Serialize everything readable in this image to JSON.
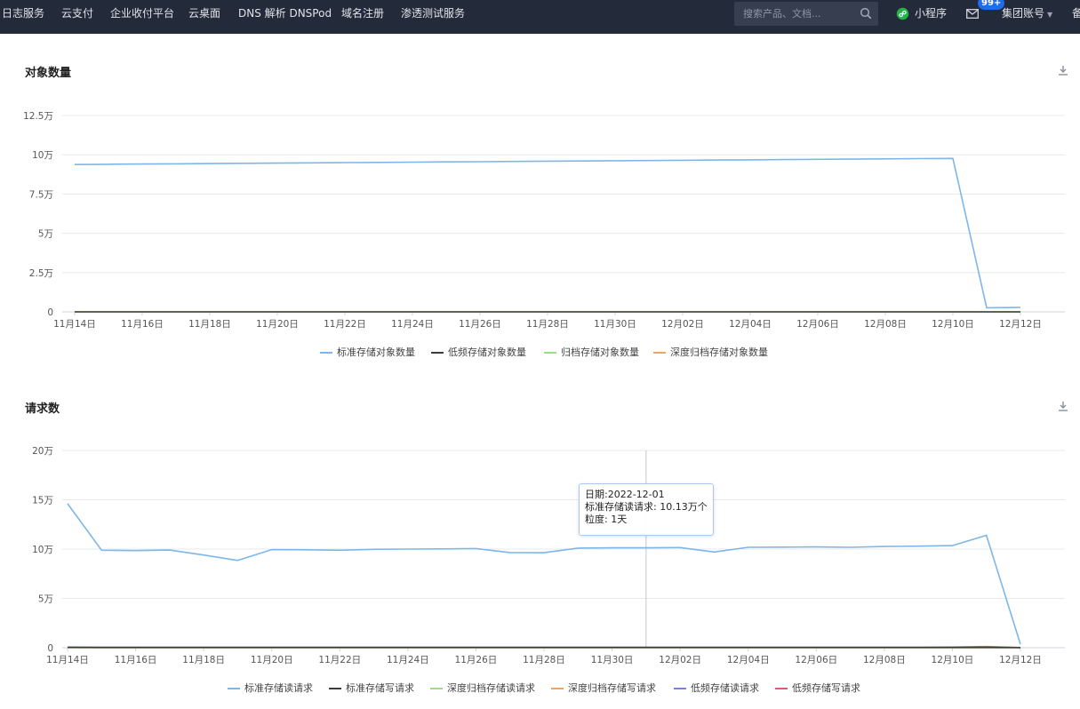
{
  "nav": {
    "items": [
      "日志服务",
      "云支付",
      "企业收付平台",
      "云桌面",
      "DNS 解析 DNSPod",
      "域名注册",
      "渗透测试服务"
    ],
    "search_placeholder": "搜索产品、文档...",
    "mini_program": "小程序",
    "mail_badge": "99+",
    "account": "集团账号",
    "overflow": "备"
  },
  "icons": {
    "search": "search-icon",
    "mini_program": "mini-program-icon",
    "mail": "mail-icon",
    "download": "download-icon"
  },
  "colors": {
    "topbar": "#232a39",
    "std_blue": "#7eb6ea",
    "low_dark": "#3c3c3c",
    "archive_green": "#98e086",
    "deep_orange": "#f5a35b",
    "low_read_purple": "#7b7fe0",
    "low_write_pink": "#e8537a"
  },
  "panels": {
    "objects": {
      "title": "对象数量"
    },
    "requests": {
      "title": "请求数"
    }
  },
  "tooltip": {
    "date": "日期:2022-12-01",
    "value": "标准存储读请求: 10.13万个",
    "granularity": "粒度:  1天"
  },
  "chart_data": [
    {
      "type": "line",
      "title": "对象数量",
      "xlabel": "",
      "ylabel": "",
      "x": [
        "11-14",
        "11-15",
        "11-16",
        "11-17",
        "11-18",
        "11-19",
        "11-20",
        "11-21",
        "11-22",
        "11-23",
        "11-24",
        "11-25",
        "11-26",
        "11-27",
        "11-28",
        "11-29",
        "11-30",
        "12-01",
        "12-02",
        "12-03",
        "12-04",
        "12-05",
        "12-06",
        "12-07",
        "12-08",
        "12-09",
        "12-10",
        "12-11",
        "12-12"
      ],
      "xticks": [
        "11月14日",
        "11月16日",
        "11月18日",
        "11月20日",
        "11月22日",
        "11月24日",
        "11月26日",
        "11月28日",
        "11月30日",
        "12月02日",
        "12月04日",
        "12月06日",
        "12月08日",
        "12月10日",
        "12月12日"
      ],
      "yticks": [
        "0",
        "2.5万",
        "5万",
        "7.5万",
        "10万",
        "12.5万"
      ],
      "ylim": [
        0,
        125000
      ],
      "grid": true,
      "legend_position": "bottom",
      "series": [
        {
          "name": "标准存储对象数量",
          "color": "#7eb6ea",
          "values": [
            93800,
            93950,
            94100,
            94250,
            94400,
            94550,
            94700,
            94850,
            95000,
            95150,
            95300,
            95450,
            95600,
            95750,
            95900,
            96050,
            96200,
            96350,
            96500,
            96650,
            96800,
            96950,
            97100,
            97250,
            97400,
            97550,
            97700,
            2600,
            2800
          ]
        },
        {
          "name": "低频存储对象数量",
          "color": "#3c3c3c",
          "values": [
            0,
            0,
            0,
            0,
            0,
            0,
            0,
            0,
            0,
            0,
            0,
            0,
            0,
            0,
            0,
            0,
            0,
            0,
            0,
            0,
            0,
            0,
            0,
            0,
            0,
            0,
            0,
            0,
            0
          ]
        },
        {
          "name": "归档存储对象数量",
          "color": "#98e086",
          "values": [
            0,
            0,
            0,
            0,
            0,
            0,
            0,
            0,
            0,
            0,
            0,
            0,
            0,
            0,
            0,
            0,
            0,
            0,
            0,
            0,
            0,
            0,
            0,
            0,
            0,
            0,
            0,
            0,
            0
          ]
        },
        {
          "name": "深度归档存储对象数量",
          "color": "#f5a35b",
          "values": [
            0,
            0,
            0,
            0,
            0,
            0,
            0,
            0,
            0,
            0,
            0,
            0,
            0,
            0,
            0,
            0,
            0,
            0,
            0,
            0,
            0,
            0,
            0,
            0,
            0,
            0,
            0,
            0,
            0
          ]
        }
      ]
    },
    {
      "type": "line",
      "title": "请求数",
      "xlabel": "",
      "ylabel": "",
      "x": [
        "11-14",
        "11-15",
        "11-16",
        "11-17",
        "11-18",
        "11-19",
        "11-20",
        "11-21",
        "11-22",
        "11-23",
        "11-24",
        "11-25",
        "11-26",
        "11-27",
        "11-28",
        "11-29",
        "11-30",
        "12-01",
        "12-02",
        "12-03",
        "12-04",
        "12-05",
        "12-06",
        "12-07",
        "12-08",
        "12-09",
        "12-10",
        "12-11",
        "12-12"
      ],
      "xticks": [
        "11月14日",
        "11月16日",
        "11月18日",
        "11月20日",
        "11月22日",
        "11月24日",
        "11月26日",
        "11月28日",
        "11月30日",
        "12月02日",
        "12月04日",
        "12月06日",
        "12月08日",
        "12月10日",
        "12月12日"
      ],
      "yticks": [
        "0",
        "5万",
        "10万",
        "15万",
        "20万"
      ],
      "ylim": [
        0,
        200000
      ],
      "grid": true,
      "legend_position": "bottom",
      "series": [
        {
          "name": "标准存储读请求",
          "color": "#7eb6ea",
          "values": [
            146000,
            98800,
            98500,
            99000,
            94000,
            88500,
            99500,
            99300,
            98800,
            99700,
            100000,
            100200,
            100500,
            96500,
            96300,
            101000,
            101300,
            101300,
            101500,
            97000,
            101800,
            102000,
            102200,
            101800,
            102600,
            103000,
            103500,
            114000,
            3500
          ]
        },
        {
          "name": "标准存储写请求",
          "color": "#3c3c3c",
          "values": [
            400,
            300,
            300,
            300,
            300,
            300,
            300,
            300,
            300,
            300,
            300,
            300,
            300,
            300,
            300,
            300,
            300,
            300,
            300,
            300,
            300,
            300,
            300,
            300,
            300,
            300,
            300,
            300,
            100
          ]
        },
        {
          "name": "深度归档存储读请求",
          "color": "#98e086",
          "values": [
            0,
            0,
            0,
            0,
            0,
            0,
            0,
            0,
            0,
            0,
            0,
            0,
            0,
            0,
            0,
            0,
            0,
            0,
            0,
            0,
            0,
            0,
            0,
            0,
            0,
            0,
            0,
            0,
            0
          ]
        },
        {
          "name": "深度归档存储写请求",
          "color": "#f5a35b",
          "values": [
            0,
            0,
            0,
            0,
            0,
            0,
            0,
            0,
            0,
            0,
            0,
            0,
            0,
            0,
            0,
            0,
            0,
            0,
            0,
            0,
            0,
            0,
            0,
            0,
            0,
            0,
            0,
            0,
            0
          ]
        },
        {
          "name": "低频存储读请求",
          "color": "#7b7fe0",
          "values": [
            0,
            0,
            0,
            0,
            0,
            0,
            0,
            0,
            0,
            0,
            0,
            0,
            0,
            0,
            0,
            0,
            0,
            0,
            0,
            0,
            0,
            0,
            0,
            0,
            0,
            0,
            0,
            0,
            0
          ]
        },
        {
          "name": "低频存储写请求",
          "color": "#e8537a",
          "values": [
            500,
            400,
            400,
            400,
            400,
            400,
            400,
            400,
            400,
            400,
            400,
            400,
            400,
            400,
            400,
            400,
            400,
            400,
            400,
            400,
            400,
            400,
            400,
            400,
            400,
            400,
            600,
            1200,
            200
          ]
        }
      ]
    }
  ]
}
